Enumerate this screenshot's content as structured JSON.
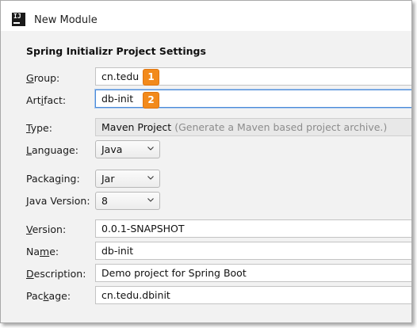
{
  "window": {
    "title": "New Module"
  },
  "section": {
    "title": "Spring Initializr Project Settings"
  },
  "group": {
    "label_u": "G",
    "label_rest": "roup:",
    "value": "cn.tedu",
    "badge": "1"
  },
  "artifact": {
    "label_pre": "Art",
    "label_u": "i",
    "label_rest": "fact:",
    "value": "db-init",
    "badge": "2"
  },
  "type": {
    "label_u": "T",
    "label_rest": "ype:",
    "value": "Maven Project",
    "hint": "(Generate a Maven based project archive.)"
  },
  "language": {
    "label_u": "L",
    "label_rest": "anguage:",
    "value": "Java"
  },
  "packaging": {
    "label_pre": "Packa",
    "label_u": "g",
    "label_rest": "ing:",
    "value": "Jar"
  },
  "java_version": {
    "label_u": "J",
    "label_rest": "ava Version:",
    "value": "8"
  },
  "version": {
    "label_u": "V",
    "label_rest": "ersion:",
    "value": "0.0.1-SNAPSHOT"
  },
  "name": {
    "label_pre": "Na",
    "label_u": "m",
    "label_rest": "e:",
    "value": "db-init"
  },
  "description": {
    "label_u": "D",
    "label_rest": "escription:",
    "value": "Demo project for Spring Boot"
  },
  "package": {
    "label_pre": "Pac",
    "label_u": "k",
    "label_rest": "age:",
    "value": "cn.tedu.dbinit"
  },
  "colors": {
    "badge": "#f28a1c",
    "focus": "#4a8ad8",
    "background": "#f2f2f2"
  },
  "icons": [
    "intellij-app-icon",
    "chevron-down-icon"
  ]
}
